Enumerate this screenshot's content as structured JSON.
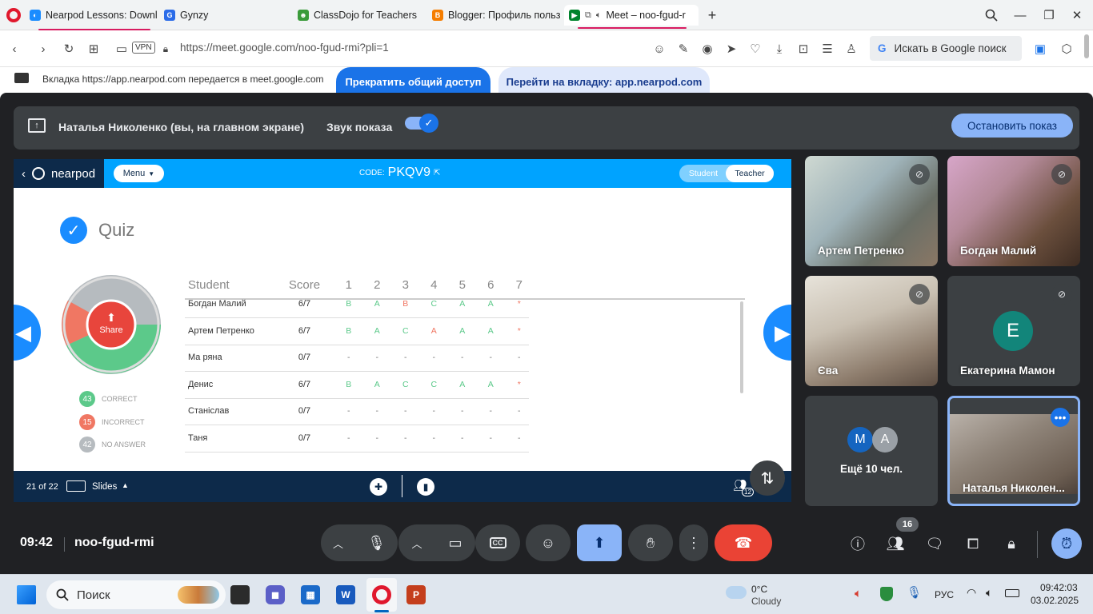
{
  "browser": {
    "tabs": [
      {
        "title": "Nearpod Lessons: Downlo",
        "favicon_color": "#1a8cff"
      },
      {
        "title": "Gynzy",
        "favicon_color": "#2b6ce8"
      },
      {
        "title": "ClassDojo for Teachers",
        "favicon_color": "#3a9b3a"
      },
      {
        "title": "Blogger: Профиль пользо",
        "favicon_color": "#f57d00"
      },
      {
        "title": "Meet – noo-fgud-r",
        "favicon_color": "#00832d"
      }
    ],
    "url": "https://meet.google.com/noo-fgud-rmi?pli=1",
    "vpn_label": "VPN",
    "search_placeholder": "Искать в Google поиск",
    "accent_color": "#d81b60"
  },
  "share_banner": {
    "text": "Вкладка https://app.nearpod.com передается в meet.google.com",
    "stop_button": "Прекратить общий доступ",
    "goto_button": "Перейти на вкладку: app.nearpod.com"
  },
  "presentation_bar": {
    "presenter": "Наталья Николенко (вы, на главном экране)",
    "sound_label": "Звук показа",
    "stop_button": "Остановить показ"
  },
  "nearpod": {
    "logo": "nearpod",
    "menu": "Menu",
    "code_label": "CODE:",
    "code": "PKQV9",
    "toggle_student": "Student",
    "toggle_teacher": "Teacher",
    "quiz_title": "Quiz",
    "share_label": "Share",
    "legend": [
      {
        "count": "43",
        "label": "CORRECT",
        "color": "#5cc98a"
      },
      {
        "count": "15",
        "label": "INCORRECT",
        "color": "#f07763"
      },
      {
        "count": "42",
        "label": "NO ANSWER",
        "color": "#b6bbbf"
      }
    ],
    "table": {
      "headers": [
        "Student",
        "Score",
        "1",
        "2",
        "3",
        "4",
        "5",
        "6",
        "7"
      ],
      "rows": [
        {
          "name": "Богдан Малий",
          "score": "6/7",
          "answers": [
            "B",
            "A",
            "B",
            "C",
            "A",
            "A",
            "*"
          ]
        },
        {
          "name": "Артем Петренко",
          "score": "6/7",
          "answers": [
            "B",
            "A",
            "C",
            "A",
            "A",
            "A",
            "*"
          ]
        },
        {
          "name": "Ма ряна",
          "score": "0/7",
          "answers": [
            "-",
            "-",
            "-",
            "-",
            "-",
            "-",
            "-"
          ]
        },
        {
          "name": "Денис",
          "score": "6/7",
          "answers": [
            "B",
            "A",
            "C",
            "C",
            "A",
            "A",
            "*"
          ]
        },
        {
          "name": "Станіслав",
          "score": "0/7",
          "answers": [
            "-",
            "-",
            "-",
            "-",
            "-",
            "-",
            "-"
          ]
        },
        {
          "name": "Таня",
          "score": "0/7",
          "answers": [
            "-",
            "-",
            "-",
            "-",
            "-",
            "-",
            "-"
          ]
        }
      ]
    },
    "footer": {
      "slide_counter": "21 of 22",
      "slides_label": "Slides",
      "participants_badge": "12"
    }
  },
  "participants": [
    {
      "name": "Артем Петренко",
      "muted": true
    },
    {
      "name": "Богдан Малий",
      "muted": true
    },
    {
      "name": "Єва",
      "muted": true
    },
    {
      "name": "Екатерина Мамон",
      "muted": true,
      "avatar_letter": "E",
      "avatar_color": "#12857a"
    },
    {
      "name": "Ещё 10 чел.",
      "avatar_letters": [
        "M",
        "A"
      ]
    },
    {
      "name": "Наталья Николен..."
    }
  ],
  "meet_footer": {
    "time": "09:42",
    "meeting_code": "noo-fgud-rmi",
    "people_count": "16"
  },
  "taskbar": {
    "search_placeholder": "Поиск",
    "weather_temp": "0°C",
    "weather_desc": "Cloudy",
    "language": "РУС",
    "time": "09:42:03",
    "date": "03.02.2025"
  }
}
